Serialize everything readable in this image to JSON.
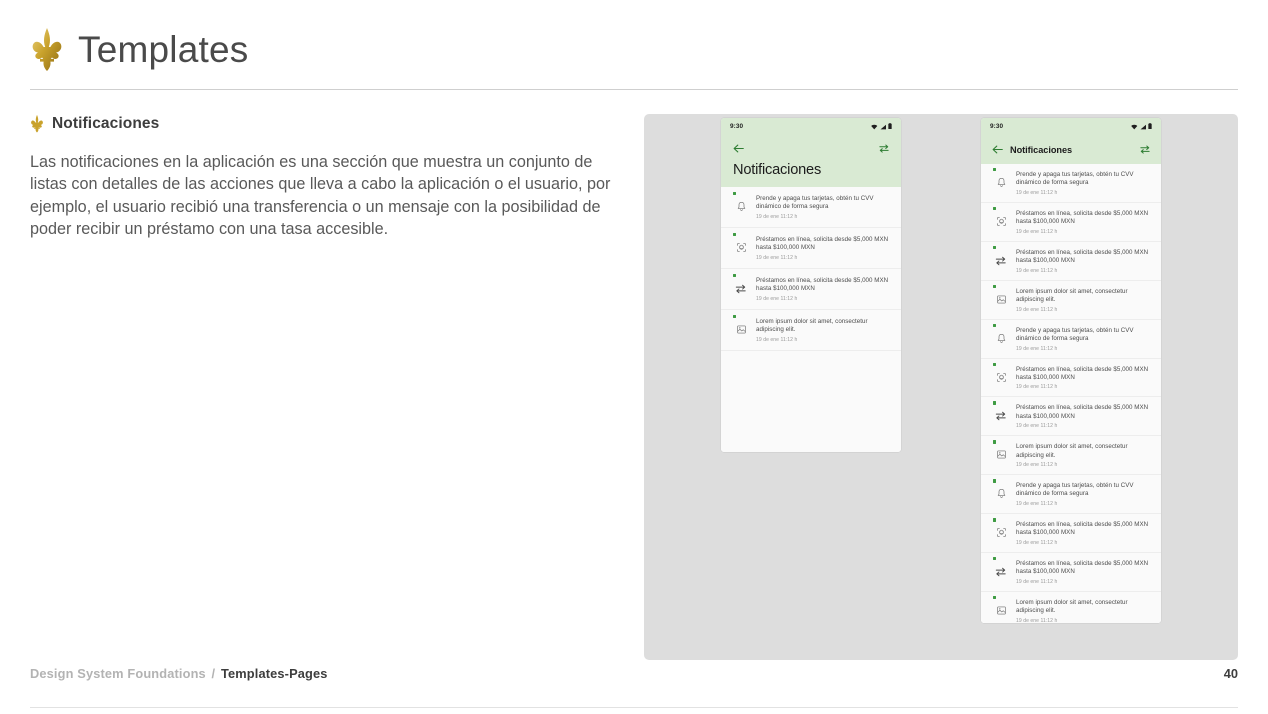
{
  "header": {
    "title": "Templates",
    "logo_icon": "fleur-de-lis-icon"
  },
  "section": {
    "title": "Notificaciones",
    "bullet_icon": "fleur-de-lis-icon",
    "paragraph": "Las notificaciones en la aplicación es una sección que muestra un conjunto de listas con detalles de las acciones que lleva a cabo la aplicación o el usuario, por ejemplo, el usuario recibió una transferencia o un mensaje con la posibilidad de poder recibir un préstamo con una tasa accesible."
  },
  "colors": {
    "brand_gold": "#c8a02a",
    "phone_header_green": "#d9ead3",
    "accent_green": "#3e9b43",
    "panel_gray": "#dddddd",
    "text_body": "#595959"
  },
  "showcase": {
    "phones": [
      {
        "name": "notifications-screen-large-title",
        "statusbar": {
          "time": "9:30",
          "icons": [
            "wifi-icon",
            "signal-icon",
            "battery-icon"
          ]
        },
        "appbar": {
          "back_icon": "arrow-left-icon",
          "action_icon": "swap-icon",
          "title": "Notificaciones",
          "style": "large-title"
        },
        "items": [
          {
            "icon": "bell-icon",
            "unread": true,
            "text": "Prende y apaga tus tarjetas, obtén tu CVV dinámico de forma segura",
            "time": "19 de ene 11:12 h"
          },
          {
            "icon": "face-scan-icon",
            "unread": true,
            "text": "Préstamos en línea, solicita desde $5,000 MXN hasta $100,000 MXN",
            "time": "19 de ene 11:12 h"
          },
          {
            "icon": "swap-icon",
            "unread": true,
            "text": "Préstamos en línea, solicita desde $5,000 MXN hasta $100,000 MXN",
            "time": "19 de ene 11:12 h"
          },
          {
            "icon": "image-placeholder-icon",
            "unread": true,
            "text": "Lorem ipsum dolor sit amet, consectetur adipiscing elit.",
            "time": "19 de ene 11:12 h"
          }
        ]
      },
      {
        "name": "notifications-screen-compact-title",
        "statusbar": {
          "time": "9:30",
          "icons": [
            "wifi-icon",
            "signal-icon",
            "battery-icon"
          ]
        },
        "appbar": {
          "back_icon": "arrow-left-icon",
          "action_icon": "swap-icon",
          "title": "Notificaciones",
          "style": "compact-title"
        },
        "items": [
          {
            "icon": "bell-icon",
            "unread": true,
            "text": "Prende y apaga tus tarjetas, obtén tu CVV dinámico de forma segura",
            "time": "19 de ene 11:12 h"
          },
          {
            "icon": "face-scan-icon",
            "unread": true,
            "text": "Préstamos en línea, solicita desde $5,000 MXN hasta $100,000 MXN",
            "time": "19 de ene 11:12 h"
          },
          {
            "icon": "swap-icon",
            "unread": true,
            "text": "Préstamos en línea, solicita desde $5,000 MXN hasta $100,000 MXN",
            "time": "19 de ene 11:12 h"
          },
          {
            "icon": "image-placeholder-icon",
            "unread": true,
            "text": "Lorem ipsum dolor sit amet, consectetur adipiscing elit.",
            "time": "19 de ene 11:12 h"
          },
          {
            "icon": "bell-icon",
            "unread": true,
            "text": "Prende y apaga tus tarjetas, obtén tu CVV dinámico de forma segura",
            "time": "19 de ene 11:12 h"
          },
          {
            "icon": "face-scan-icon",
            "unread": true,
            "text": "Préstamos en línea, solicita desde $5,000 MXN hasta $100,000 MXN",
            "time": "19 de ene 11:12 h"
          },
          {
            "icon": "swap-icon",
            "unread": true,
            "text": "Préstamos en línea, solicita desde $5,000 MXN hasta $100,000 MXN",
            "time": "19 de ene 11:12 h"
          },
          {
            "icon": "image-placeholder-icon",
            "unread": true,
            "text": "Lorem ipsum dolor sit amet, consectetur adipiscing elit.",
            "time": "19 de ene 11:12 h"
          },
          {
            "icon": "bell-icon",
            "unread": true,
            "text": "Prende y apaga tus tarjetas, obtén tu CVV dinámico de forma segura",
            "time": "19 de ene 11:12 h"
          },
          {
            "icon": "face-scan-icon",
            "unread": true,
            "text": "Préstamos en línea, solicita desde $5,000 MXN hasta $100,000 MXN",
            "time": "19 de ene 11:12 h"
          },
          {
            "icon": "swap-icon",
            "unread": true,
            "text": "Préstamos en línea, solicita desde $5,000 MXN hasta $100,000 MXN",
            "time": "19 de ene 11:12 h"
          },
          {
            "icon": "image-placeholder-icon",
            "unread": true,
            "text": "Lorem ipsum dolor sit amet, consectetur adipiscing elit.",
            "time": "19 de ene 11:12 h"
          }
        ]
      }
    ]
  },
  "footer": {
    "breadcrumb_muted": "Design System Foundations",
    "breadcrumb_separator": "/",
    "breadcrumb_current": "Templates-Pages",
    "page_number": "40"
  }
}
